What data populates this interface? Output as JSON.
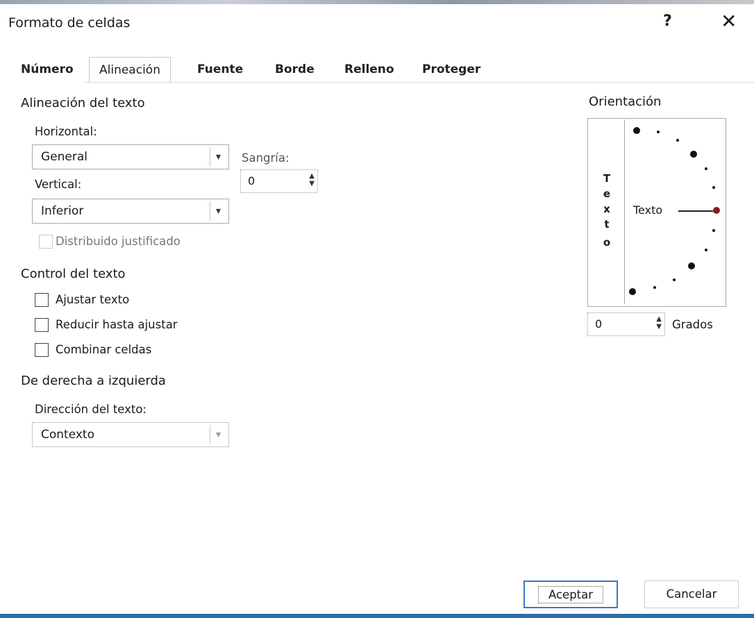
{
  "dialog": {
    "title": "Formato de celdas",
    "help_label": "?",
    "close_label": "✕"
  },
  "tabs": [
    {
      "label": "Número",
      "active": false
    },
    {
      "label": "Alineación",
      "active": true
    },
    {
      "label": "Fuente",
      "active": false
    },
    {
      "label": "Borde",
      "active": false
    },
    {
      "label": "Relleno",
      "active": false
    },
    {
      "label": "Proteger",
      "active": false
    }
  ],
  "alignment": {
    "section_title": "Alineación del texto",
    "horizontal_label": "Horizontal:",
    "horizontal_value": "General",
    "vertical_label": "Vertical:",
    "vertical_value": "Inferior",
    "indent_label": "Sangría:",
    "indent_value": "0",
    "distributed_label": "Distribuido justificado"
  },
  "text_control": {
    "section_title": "Control del texto",
    "wrap_label": "Ajustar texto",
    "shrink_label": "Reducir hasta ajustar",
    "merge_label": "Combinar celdas"
  },
  "rtl": {
    "section_title": "De derecha a izquierda",
    "direction_label": "Dirección del texto:",
    "direction_value": "Contexto"
  },
  "orientation": {
    "title": "Orientación",
    "vertical_letters": [
      "T",
      "e",
      "x",
      "t",
      "o"
    ],
    "horizontal_text": "Texto",
    "degrees_value": "0",
    "degrees_label": "Grados"
  },
  "buttons": {
    "ok_label": "Aceptar",
    "cancel_label": "Cancelar"
  },
  "colors": {
    "accent": "#3b78c7",
    "selected_dot": "#8b1a1a"
  }
}
